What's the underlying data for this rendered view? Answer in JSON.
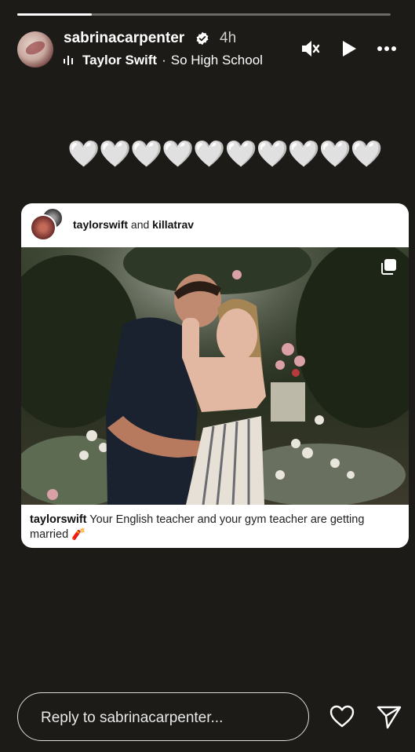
{
  "story": {
    "progress_fraction": 0.2,
    "username": "sabrinacarpenter",
    "time": "4h",
    "music": {
      "artist": "Taylor Swift",
      "separator": "·",
      "song": "So High School"
    },
    "icons": [
      "verified-badge-icon",
      "muted-speaker-icon",
      "play-icon",
      "more-options-icon"
    ]
  },
  "hearts": "🤍🤍🤍🤍🤍🤍🤍🤍🤍🤍",
  "post": {
    "author_1": "taylorswift",
    "connector": "and",
    "author_2": "killatrav",
    "caption_user": "taylorswift",
    "caption_text": "Your English teacher and your gym teacher are getting married 🧨"
  },
  "reply": {
    "placeholder": "Reply to sabrinacarpenter...",
    "icons": [
      "like-heart-icon",
      "send-icon"
    ]
  }
}
